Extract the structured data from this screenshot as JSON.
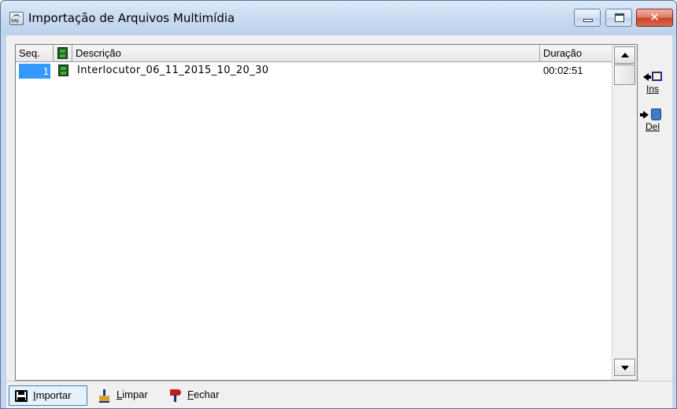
{
  "window": {
    "title": "Importação de Arquivos Multimídia",
    "close_symbol": "✕"
  },
  "grid": {
    "columns": {
      "seq": "Seq.",
      "description": "Descrição",
      "duration": "Duração"
    },
    "rows": [
      {
        "seq": "1",
        "description": "Interlocutor_06_11_2015_10_20_30",
        "duration": "00:02:51"
      }
    ]
  },
  "side_buttons": {
    "insert_label": "Ins",
    "delete_label": "Del"
  },
  "toolbar": {
    "import": {
      "first": "I",
      "rest": "mportar"
    },
    "clear": {
      "first": "L",
      "rest": "impar"
    },
    "close": {
      "first": "F",
      "rest": "echar"
    }
  },
  "icons": {
    "window": "saj-app-icon",
    "media_column": "film-icon",
    "insert": "insert-arrow-icon",
    "delete": "delete-bin-icon",
    "import": "floppy-disk-icon",
    "clear": "broom-icon",
    "close": "flag-icon"
  },
  "colors": {
    "selection": "#3399ff",
    "title_bar": "#c9dbf1",
    "close_button": "#c8452d",
    "film": "#1c5a1c"
  }
}
